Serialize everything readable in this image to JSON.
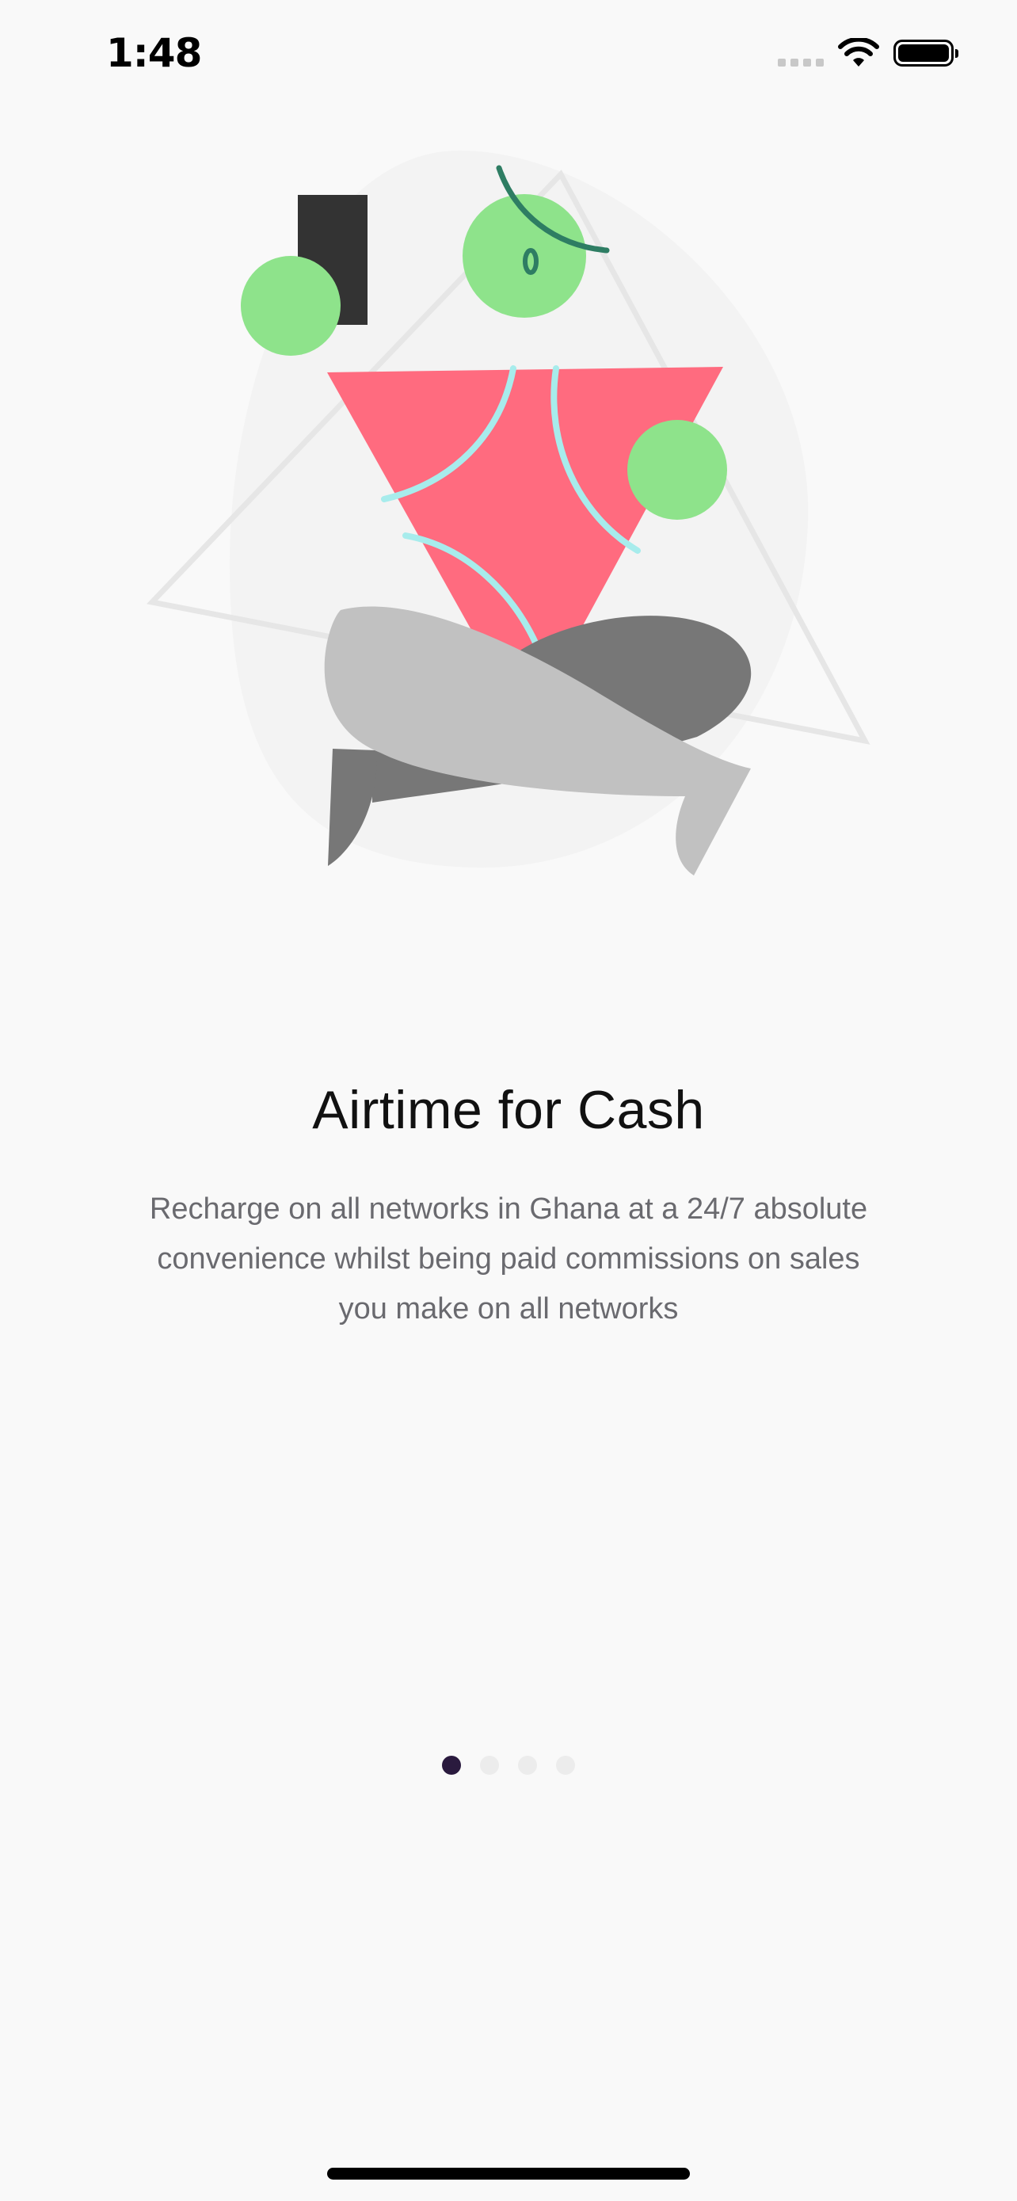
{
  "status_bar": {
    "time": "1:48",
    "icons": [
      "cellular-signal-icon",
      "wifi-icon",
      "battery-icon"
    ]
  },
  "illustration": {
    "name": "person-sitting-illustration",
    "colors": {
      "pink": "#ff6b7f",
      "green": "#8ee38b",
      "dark_green": "#2e7d63",
      "cyan": "#a7ecec",
      "gray_light": "#c1c1c1",
      "gray_dark": "#777777",
      "block": "#333333",
      "outline": "#e6e6e6"
    }
  },
  "onboarding": {
    "title": "Airtime for Cash",
    "description": "Recharge on all networks in Ghana at a 24/7 absolute convenience whilst being paid commissions on sales you make on all networks"
  },
  "pager": {
    "total": 4,
    "current": 1
  },
  "colors": {
    "background": "#f9f9f9",
    "active_dot": "#2a1a3e",
    "inactive_dot": "#ececec",
    "title_text": "#111111",
    "body_text": "#6a6a6f"
  }
}
